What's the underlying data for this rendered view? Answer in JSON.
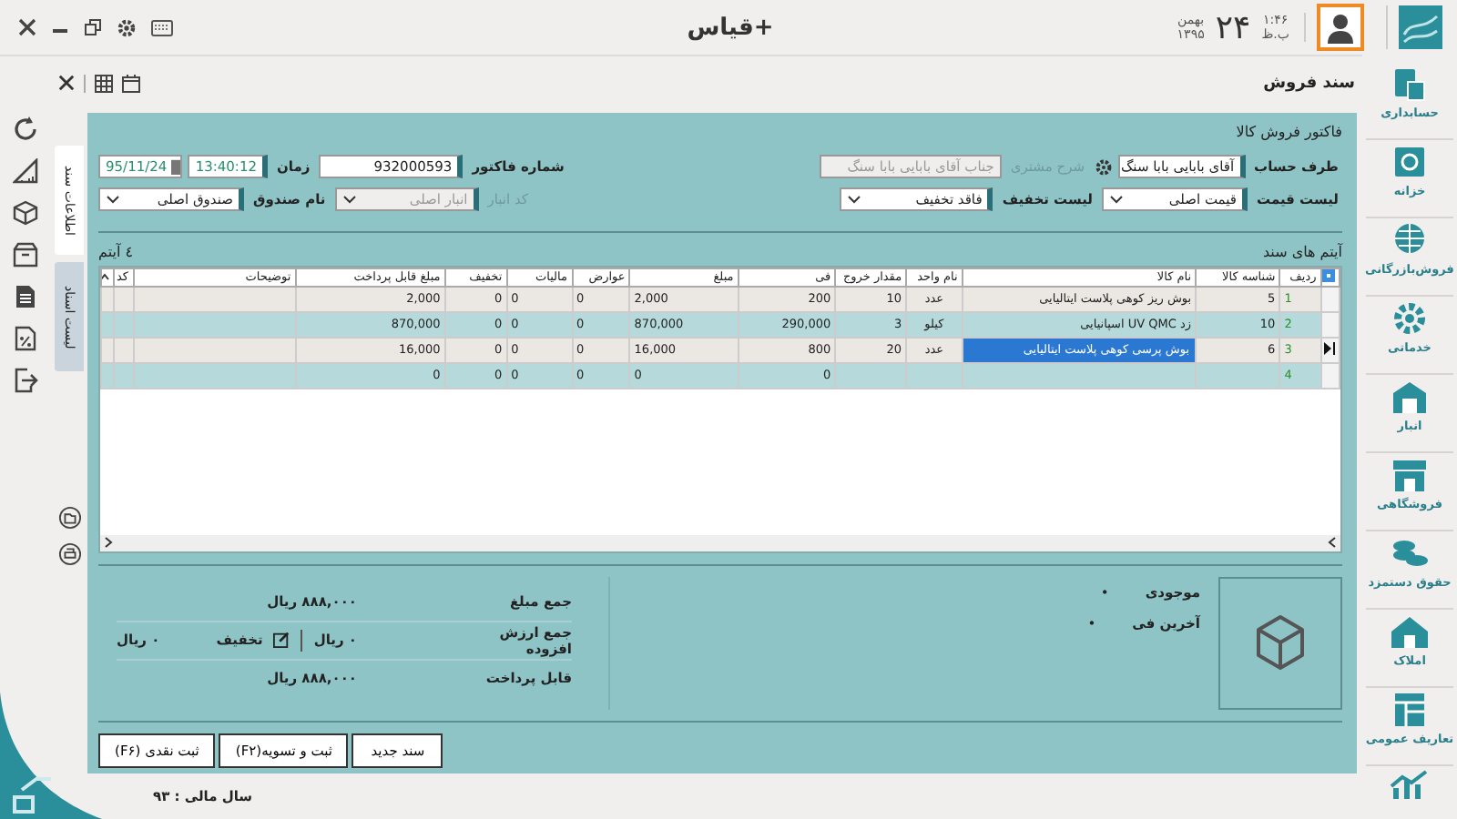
{
  "topbar": {
    "title": "قیاس+",
    "time": "۱:۴۶",
    "ampm": "ب.ظ",
    "day": "۲۴",
    "month": "بهمن",
    "year": "۱۳۹۵"
  },
  "subbar": {
    "title": "سند فروش"
  },
  "sidebar": {
    "items": [
      {
        "label": "حسابداری"
      },
      {
        "label": "خزانه"
      },
      {
        "label": "فروش‌بازرگانی"
      },
      {
        "label": "خدماتی"
      },
      {
        "label": "انبار"
      },
      {
        "label": "فروشگاهی"
      },
      {
        "label": "حقوق دستمزد"
      },
      {
        "label": "املاک"
      },
      {
        "label": "تعاریف عمومی"
      }
    ]
  },
  "side_tabs": [
    {
      "label": "اطلاعات سند",
      "selected": true
    },
    {
      "label": "لیست اسناد",
      "selected": false
    }
  ],
  "form": {
    "title": "فاکتور فروش کالا",
    "account": {
      "label": "طرف حساب",
      "value": "آقای بابایی  بابا سنگ"
    },
    "customer_desc": {
      "label": "شرح مشتری",
      "value": "جناب آقای بابایی  بابا سنگ",
      "disabled": true
    },
    "invoice_no": {
      "label": "شماره فاکتور",
      "value": "932000593"
    },
    "time": {
      "label": "زمان",
      "value": "13:40:12"
    },
    "date": {
      "value": "95/11/24"
    },
    "price_list": {
      "label": "لیست قیمت",
      "value": "قیمت اصلی"
    },
    "discount_list": {
      "label": "لیست تخفیف",
      "value": "فاقد تخفیف"
    },
    "warehouse": {
      "label": "کد انبار",
      "value": "انبار اصلی",
      "disabled": true
    },
    "cashbox": {
      "label": "نام صندوق",
      "value": "صندوق اصلی"
    }
  },
  "items": {
    "title": "آیتم های سند",
    "count": "٤ آیتم",
    "columns": [
      "ردیف",
      "شناسه کالا",
      "نام کالا",
      "نام واحد",
      "مقدار خروج",
      "فی",
      "مبلغ",
      "عوارض",
      "مالیات",
      "تخفیف",
      "مبلغ قابل پرداخت",
      "توضیحات",
      "کد"
    ],
    "rows": [
      {
        "current": false,
        "cells": [
          "1",
          "5",
          "بوش ریز کوهی پلاست ایتالیایی",
          "عدد",
          "10",
          "200",
          "2,000",
          "0",
          "0",
          "0",
          "2,000",
          null,
          null
        ]
      },
      {
        "current": false,
        "cells": [
          "2",
          "10",
          "زد UV QMC اسپانیایی",
          "کیلو",
          "3",
          "290,000",
          "870,000",
          "0",
          "0",
          "0",
          "870,000",
          null,
          null
        ]
      },
      {
        "current": true,
        "cells": [
          "3",
          "6",
          "بوش پرسی کوهی پلاست ایتالیایی",
          "عدد",
          "20",
          "800",
          "16,000",
          "0",
          "0",
          "0",
          "16,000",
          null,
          null
        ]
      },
      {
        "current": false,
        "cells": [
          "4",
          null,
          null,
          null,
          null,
          "0",
          "0",
          "0",
          "0",
          "0",
          "0",
          null,
          null
        ]
      }
    ]
  },
  "summary": {
    "stock": {
      "label": "موجودی",
      "value": "•"
    },
    "last_price": {
      "label": "آخرین فی",
      "value": "•"
    },
    "totals": [
      {
        "label": "جمع مبلغ",
        "value": "۸۸۸,۰۰۰ ریال"
      },
      {
        "label": "جمع ارزش افزوده",
        "value": "۰ ریال"
      },
      {
        "label": "قابل پرداخت",
        "value": "۸۸۸,۰۰۰ ریال"
      }
    ],
    "discount": {
      "label": "تخفیف",
      "value": "۰ ریال"
    }
  },
  "buttons": [
    "سند جدید",
    "ثبت و تسویه(F۲)",
    "ثبت نقدی (F۶)"
  ],
  "status": "سال مالی : ۹۳"
}
